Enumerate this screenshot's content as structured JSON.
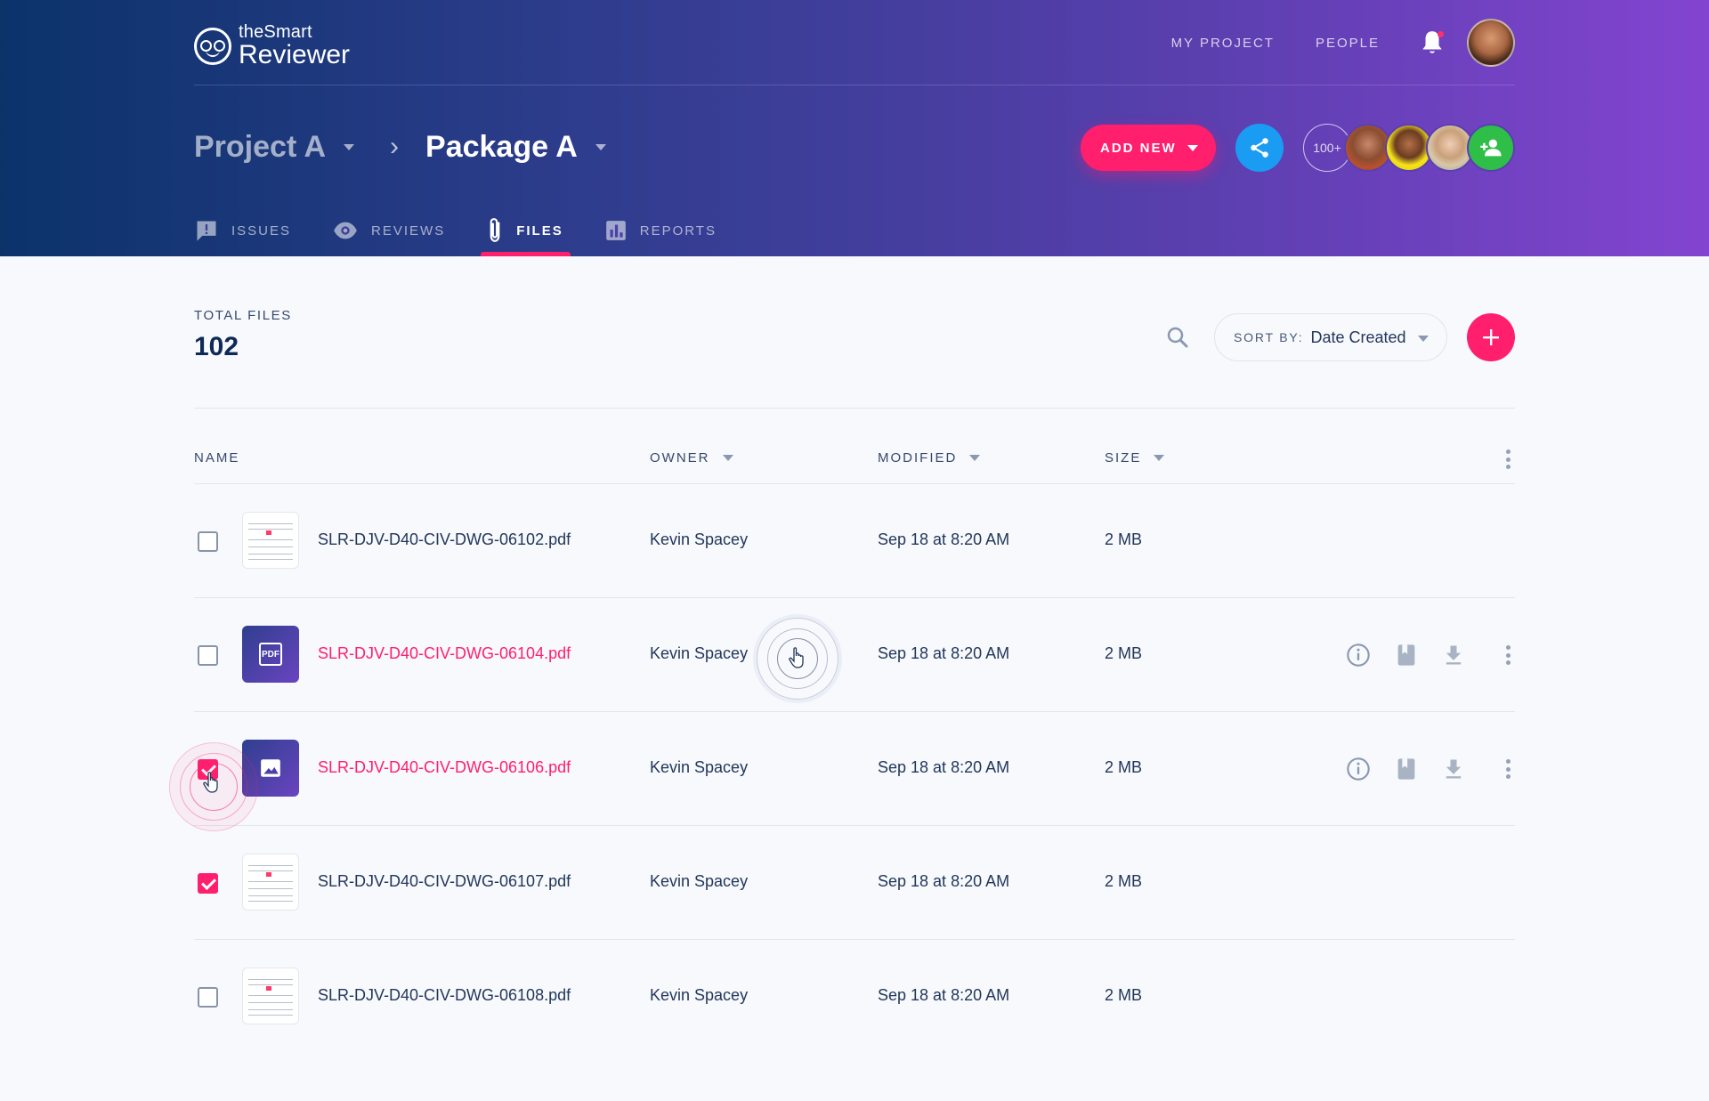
{
  "app": {
    "logo_small": "theSmart",
    "logo_big": "Reviewer"
  },
  "topnav": {
    "my_project": "MY PROJECT",
    "people": "PEOPLE"
  },
  "breadcrumb": {
    "project": "Project A",
    "package": "Package A"
  },
  "actions": {
    "add_new": "ADD NEW",
    "team_count": "100+"
  },
  "tabs": [
    {
      "label": "ISSUES",
      "icon": "alert-icon"
    },
    {
      "label": "REVIEWS",
      "icon": "eye-icon"
    },
    {
      "label": "FILES",
      "icon": "paperclip-icon",
      "active": true
    },
    {
      "label": "REPORTS",
      "icon": "bar-chart-icon"
    }
  ],
  "summary": {
    "label": "TOTAL FILES",
    "value": "102"
  },
  "sort": {
    "label": "SORT BY:",
    "value": "Date Created"
  },
  "table": {
    "headers": {
      "name": "NAME",
      "owner": "OWNER",
      "modified": "MODIFIED",
      "size": "SIZE"
    },
    "rows": [
      {
        "name": "SLR-DJV-D40-CIV-DWG-06102.pdf",
        "owner": "Kevin Spacey",
        "modified": "Sep 18 at 8:20 AM",
        "size": "2 MB",
        "checked": false,
        "thumb": "document",
        "highlight": false
      },
      {
        "name": "SLR-DJV-D40-CIV-DWG-06104.pdf",
        "owner": "Kevin Spacey",
        "modified": "Sep 18 at 8:20 AM",
        "size": "2 MB",
        "checked": false,
        "thumb": "pdf",
        "thumb_text": "PDF",
        "highlight": true
      },
      {
        "name": "SLR-DJV-D40-CIV-DWG-06106.pdf",
        "owner": "Kevin Spacey",
        "modified": "Sep 18 at 8:20 AM",
        "size": "2 MB",
        "checked": true,
        "thumb": "image",
        "highlight": true
      },
      {
        "name": "SLR-DJV-D40-CIV-DWG-06107.pdf",
        "owner": "Kevin Spacey",
        "modified": "Sep 18 at 8:20 AM",
        "size": "2 MB",
        "checked": true,
        "thumb": "document",
        "highlight": false
      },
      {
        "name": "SLR-DJV-D40-CIV-DWG-06108.pdf",
        "owner": "Kevin Spacey",
        "modified": "Sep 18 at 8:20 AM",
        "size": "2 MB",
        "checked": false,
        "thumb": "document",
        "highlight": false
      }
    ]
  },
  "colors": {
    "accent": "#ff1f6d",
    "share": "#1a9cf2",
    "add_member": "#2fbe48",
    "text": "#23375a"
  }
}
